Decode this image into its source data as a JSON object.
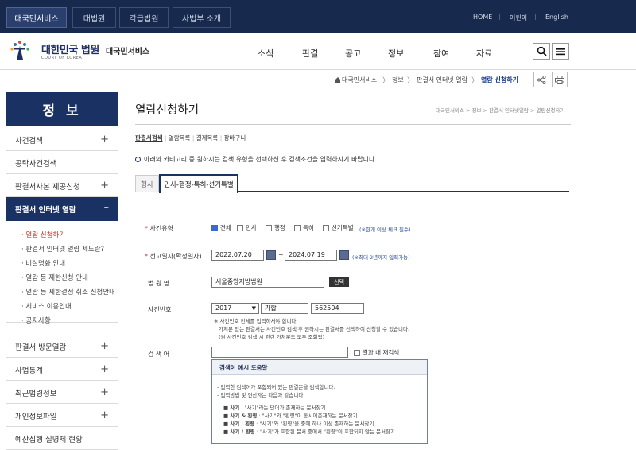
{
  "topbar": {
    "sites": [
      "대국민서비스",
      "대법원",
      "각급법원",
      "사법부 소개"
    ],
    "utils": [
      "HOME",
      "어린이",
      "English"
    ]
  },
  "header": {
    "logo_title": "대한민국 법원",
    "logo_sub": "COURT OF KOREA",
    "service": "대국민서비스",
    "gnb": [
      "소식",
      "판결",
      "공고",
      "정보",
      "참여",
      "자료"
    ]
  },
  "breadcrumb": [
    "대국민서비스",
    "정보",
    "판결서 인터넷 열람",
    "열람 신청하기"
  ],
  "sidebar": {
    "title": "정 보",
    "items_top": [
      "사건검색",
      "공탁사건검색",
      "판결서사본 제공신청"
    ],
    "open_item": "판결서 인터넷 열람",
    "subitems": [
      "열람 신청하기",
      "판결서 인터넷 열람 제도란?",
      "비실명화 안내",
      "열람 등 제한신청 안내",
      "열람 등 제한결정 취소 신청안내",
      "서비스 이용안내",
      "공지사항"
    ],
    "items_bottom": [
      "판결서 방문열람",
      "사법통계",
      "최근법령정보",
      "개인정보파일",
      "예산집행 실명제 현황"
    ]
  },
  "content": {
    "title": "열람신청하기",
    "title_crumb": "대국민서비스 > 정보 > 판결서 인터넷열람 > 열람신청하기",
    "steps": [
      "판결서검색",
      "열람목록",
      "결제목록",
      "장바구니"
    ],
    "notice": "아래의 카테고리 중 원하시는 검색 유형을 선택하신 후 검색조건을 입력하시기 바랍니다.",
    "tabs": [
      "형사",
      "민사-행정-특허-선거특별"
    ],
    "form": {
      "case_type_label": "사건유형",
      "case_types": [
        "전체",
        "민사",
        "행정",
        "특허",
        "선거특별"
      ],
      "case_type_hint": "(※한개 이상 체크 필수)",
      "date_label": "선고일자(확정일자)",
      "date_from": "2022.07.20",
      "date_sep": "~",
      "date_to": "2024.07.19",
      "date_hint": "(※최대 2년까지 입력가능)",
      "court_label": "법 원 명",
      "court_value": "서울중앙지방법원",
      "court_btn": "선택",
      "caseno_label": "사건번호",
      "case_year": "2017",
      "case_kind": "가합",
      "case_num": "562504",
      "caseno_notes": [
        "※ 사건번호 전체를 입력하셔야 합니다.",
        "가처분 있는 판결서는 사건번호 검색 후 원하시는 판결서를 선택하여 신청할 수 있습니다.",
        "(원 사건번호 검색 시 관련 가처분도 모두 조회됨)"
      ],
      "keyword_label": "검 색 어",
      "result_chk": "결과 내 재검색"
    },
    "help": {
      "title": "검색어 예시 도움말",
      "lines": [
        "- 입력한 검색어가 포함되어 있는 판결문을 검색합니다.",
        "- 입력방법 및 연산자는 다음과 같습니다."
      ],
      "ops": [
        {
          "term": "사기",
          "desc": ": \"사기\"라는 단어가 존재하는 문서찾기."
        },
        {
          "term": "사기 & 횡령",
          "desc": ": \"사기\"와 \"횡령\"이 동시에존재하는 문서찾기."
        },
        {
          "term": "사기 | 횡령",
          "desc": ": \"사기\"와 \"횡령\"을 중에 하나 이상 존재하는 문서찾기."
        },
        {
          "term": "사기 ! 횡령",
          "desc": ": \"사기\"가 포함된 문서 중에서 \"횡령\"이 포함되지 않는 문서찾기."
        }
      ]
    }
  }
}
